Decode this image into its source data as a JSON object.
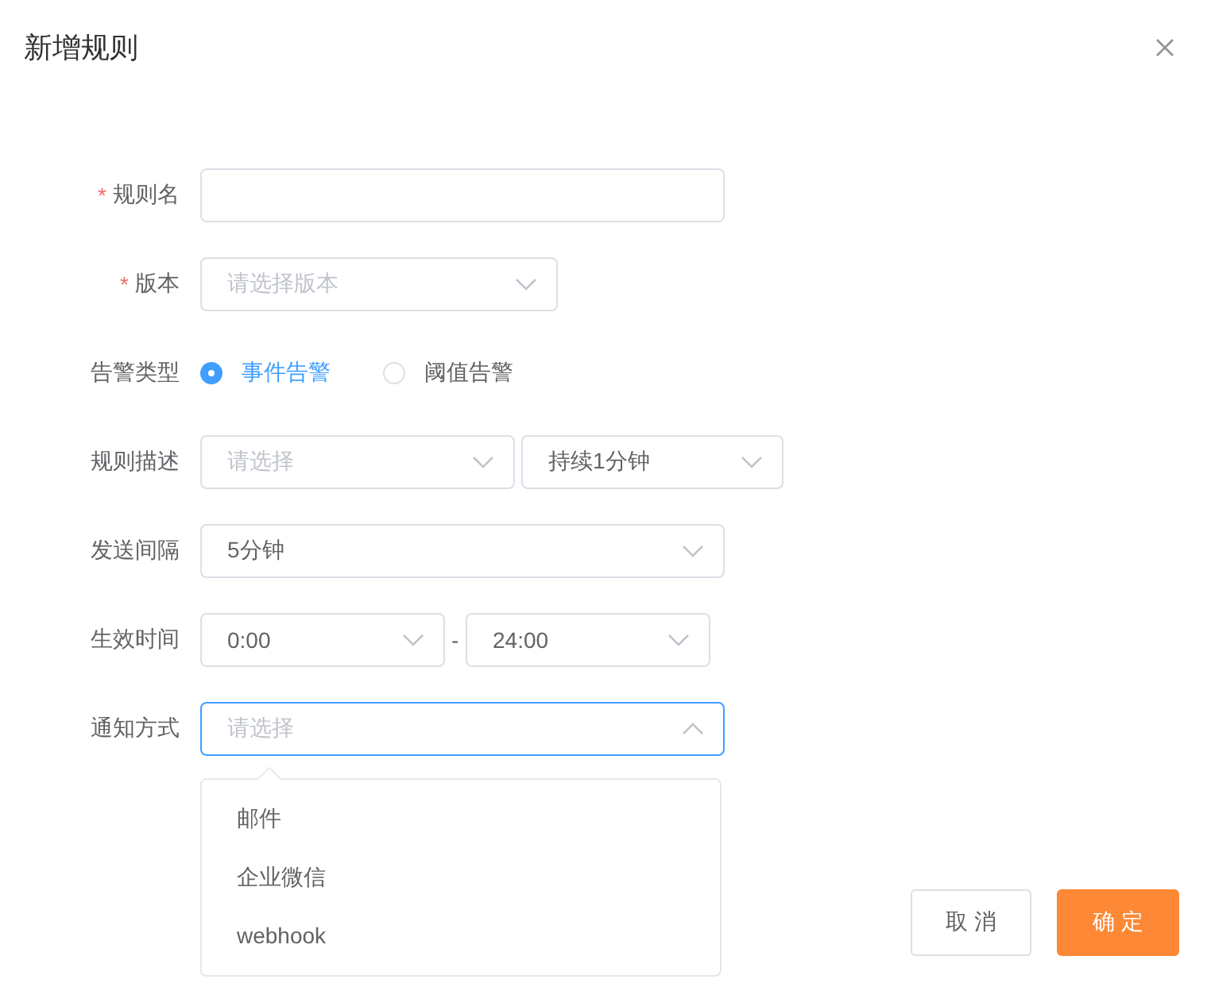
{
  "dialog": {
    "title": "新增规则"
  },
  "fields": [
    {
      "kind": "input",
      "label": "规则名",
      "mark": "*"
    },
    {
      "kind": "select",
      "label": "版本",
      "mark": "*",
      "placeholder": "请选择版本",
      "open": false
    },
    {
      "kind": "radio",
      "label": "告警类型",
      "options": [
        {
          "label": "事件告警",
          "selected": true
        },
        {
          "label": "阈值告警",
          "selected": false
        }
      ]
    },
    {
      "kind": "pair",
      "label": "规则描述",
      "selects": [
        {
          "placeholder": "请选择"
        },
        {
          "value": "持续1分钟"
        }
      ]
    },
    {
      "kind": "select",
      "label": "发送间隔",
      "value": "5分钟",
      "open": false
    },
    {
      "kind": "pair",
      "label": "生效时间",
      "separator": "-",
      "selects": [
        {
          "value": "0:00"
        },
        {
          "value": "24:00"
        }
      ]
    },
    {
      "kind": "select",
      "label": "通知方式",
      "placeholder": "请选择",
      "open": true,
      "options": [
        "邮件",
        "企业微信",
        "webhook"
      ]
    }
  ],
  "buttons": [
    {
      "label": "取 消",
      "kind": "default"
    },
    {
      "label": "确 定",
      "kind": "primary"
    }
  ]
}
